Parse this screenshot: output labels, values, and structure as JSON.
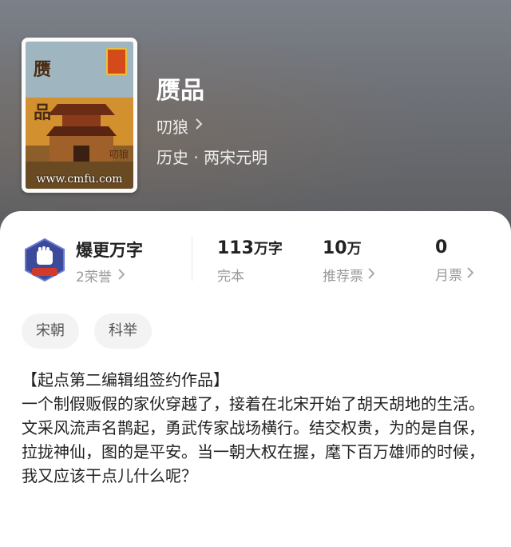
{
  "book": {
    "title": "赝品",
    "author": "叨狼",
    "genre": "历史 · 两宋元明",
    "cover": {
      "title_chars": [
        "赝",
        "品"
      ],
      "author_mark": "叨狼",
      "url_text": "www.cmfu.com"
    }
  },
  "honor": {
    "title": "爆更万字",
    "subtitle": "2荣誉",
    "badge_text": "爆更"
  },
  "stats": {
    "words": {
      "value": "113",
      "unit": "万字",
      "label": "完本"
    },
    "recommend": {
      "value": "10",
      "unit": "万",
      "label": "推荐票"
    },
    "monthly": {
      "value": "0",
      "label": "月票"
    }
  },
  "tags": [
    "宋朝",
    "科举"
  ],
  "description": {
    "line1": "【起点第二编辑组签约作品】",
    "body": "一个制假贩假的家伙穿越了，接着在北宋开始了胡天胡地的生活。文采风流声名鹊起，勇武传家战场横行。结交权贵，为的是自保，拉拢神仙，图的是平安。当一朝大权在握，麾下百万雄师的时候，我又应该干点儿什么呢？"
  },
  "icons": {
    "author_chevron": "chevron-right-icon",
    "honor_chevron": "chevron-right-icon",
    "recommend_chevron": "chevron-right-icon",
    "monthly_chevron": "chevron-right-icon",
    "honor_badge": "fist-badge-icon"
  }
}
